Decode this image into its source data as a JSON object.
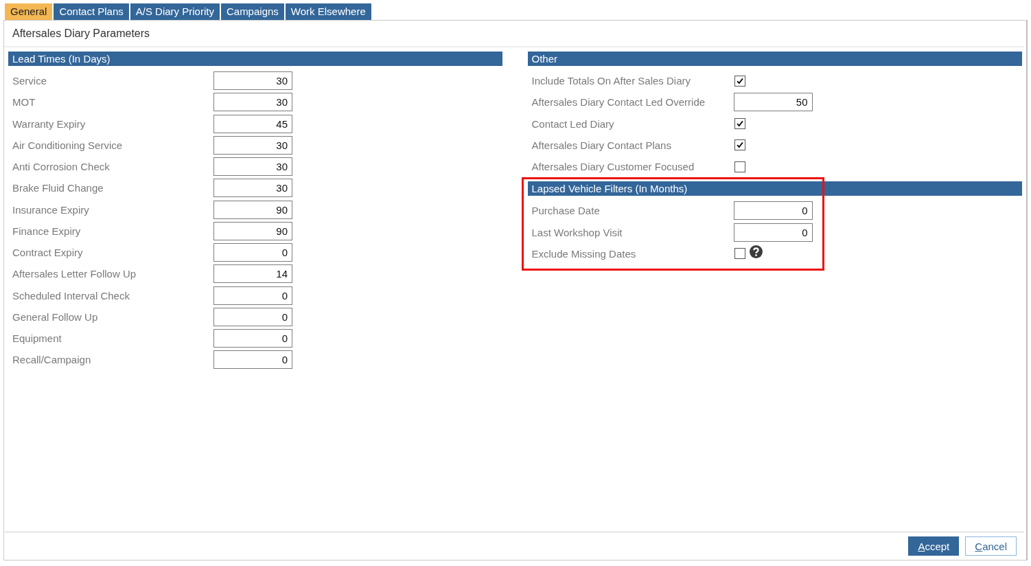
{
  "tabs": [
    {
      "label": "General",
      "selected": true
    },
    {
      "label": "Contact Plans",
      "selected": false
    },
    {
      "label": "A/S Diary Priority",
      "selected": false
    },
    {
      "label": "Campaigns",
      "selected": false
    },
    {
      "label": "Work Elsewhere",
      "selected": false
    }
  ],
  "page_title": "Aftersales Diary Parameters",
  "lead_times": {
    "title": "Lead Times (In Days)",
    "rows": [
      {
        "label": "Service",
        "value": "30"
      },
      {
        "label": "MOT",
        "value": "30"
      },
      {
        "label": "Warranty Expiry",
        "value": "45"
      },
      {
        "label": "Air Conditioning Service",
        "value": "30"
      },
      {
        "label": "Anti Corrosion Check",
        "value": "30"
      },
      {
        "label": "Brake Fluid Change",
        "value": "30"
      },
      {
        "label": "Insurance Expiry",
        "value": "90"
      },
      {
        "label": "Finance Expiry",
        "value": "90"
      },
      {
        "label": "Contract Expiry",
        "value": "0"
      },
      {
        "label": "Aftersales Letter Follow Up",
        "value": "14"
      },
      {
        "label": "Scheduled Interval Check",
        "value": "0"
      },
      {
        "label": "General Follow Up",
        "value": "0"
      },
      {
        "label": "Equipment",
        "value": "0"
      },
      {
        "label": "Recall/Campaign",
        "value": "0"
      }
    ]
  },
  "other": {
    "title": "Other",
    "rows": [
      {
        "kind": "checkbox",
        "label": "Include Totals On After Sales Diary",
        "checked": true
      },
      {
        "kind": "number",
        "label": "Aftersales Diary Contact Led Override",
        "value": "50"
      },
      {
        "kind": "checkbox",
        "label": "Contact Led Diary",
        "checked": true
      },
      {
        "kind": "checkbox",
        "label": "Aftersales Diary Contact Plans",
        "checked": true
      },
      {
        "kind": "checkbox",
        "label": "Aftersales Diary Customer Focused",
        "checked": false
      }
    ]
  },
  "lapsed_vehicle_filters": {
    "title": "Lapsed Vehicle Filters (In Months)",
    "highlighted": true,
    "rows": [
      {
        "kind": "number",
        "label": "Purchase Date",
        "value": "0"
      },
      {
        "kind": "number",
        "label": "Last Workshop Visit",
        "value": "0"
      },
      {
        "kind": "checkbox",
        "label": "Exclude Missing Dates",
        "checked": false,
        "help": true
      }
    ]
  },
  "buttons": [
    {
      "kind": "primary",
      "label": "Accept"
    },
    {
      "kind": "secondary",
      "label": "Cancel"
    }
  ]
}
